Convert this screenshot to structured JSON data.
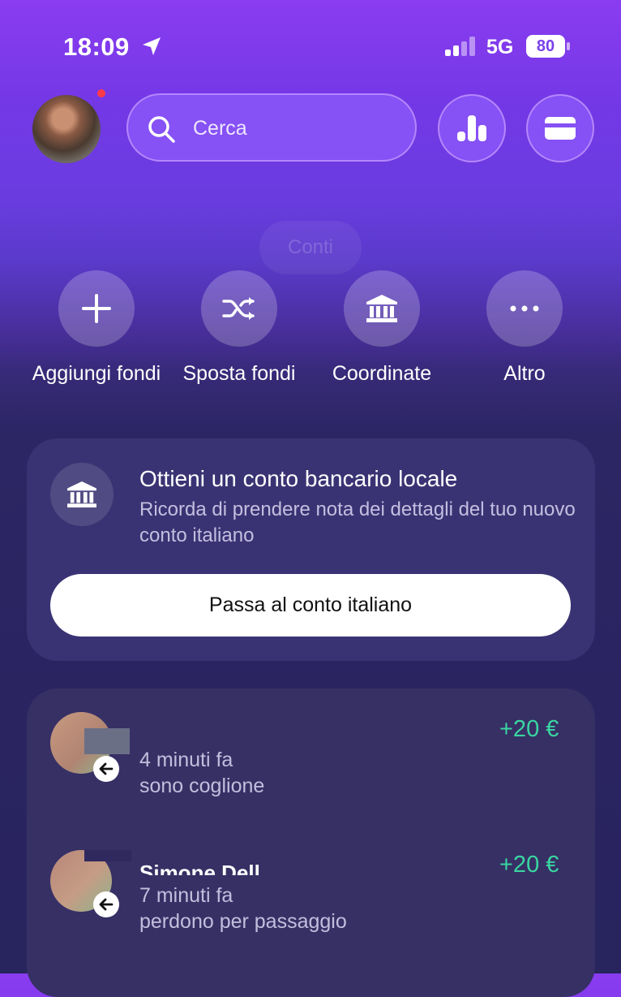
{
  "status_bar": {
    "time": "18:09",
    "network": "5G",
    "battery": "80"
  },
  "header": {
    "search_placeholder": "Cerca",
    "conti_label": "Conti"
  },
  "actions": [
    {
      "label": "Aggiungi fondi",
      "icon": "plus-icon"
    },
    {
      "label": "Sposta fondi",
      "icon": "shuffle-icon"
    },
    {
      "label": "Coordinate",
      "icon": "bank-icon"
    },
    {
      "label": "Altro",
      "icon": "more-icon"
    }
  ],
  "promo": {
    "title": "Ottieni un conto bancario locale",
    "subtitle": "Ricorda di prendere nota dei dettagli del tuo nuovo conto italiano",
    "button_label": "Passa al conto italiano"
  },
  "transactions": [
    {
      "name": "",
      "time": "4 minuti fa",
      "note": "sono coglione",
      "amount": "+20 €"
    },
    {
      "name": "Simone Dell",
      "time": "7 minuti fa",
      "note": "perdono per passaggio",
      "amount": "+20 €"
    }
  ],
  "colors": {
    "accent": "#8651f5",
    "positive": "#3ad6a0"
  }
}
